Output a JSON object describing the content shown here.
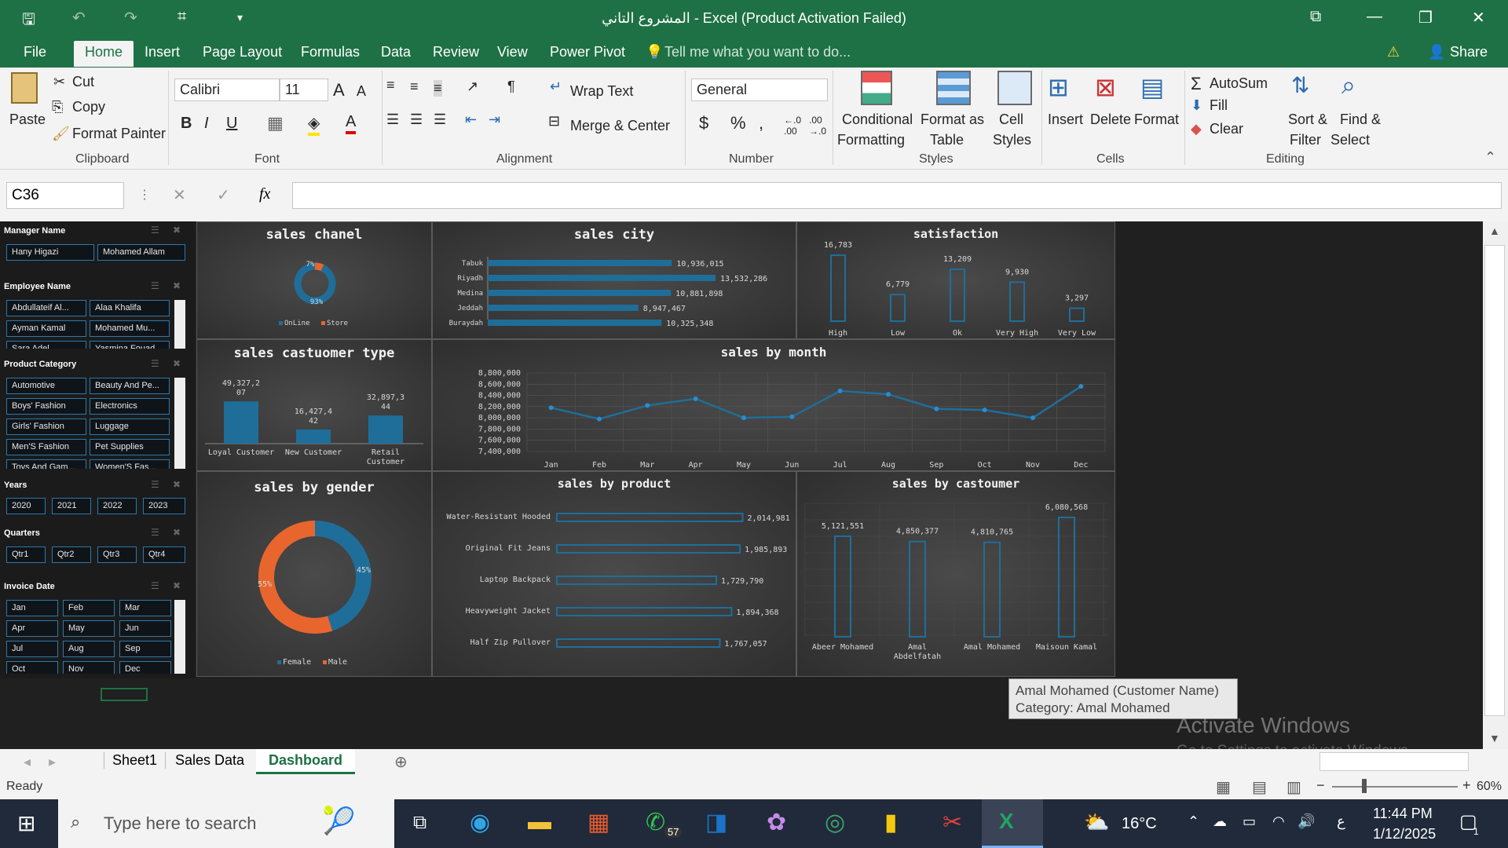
{
  "window": {
    "title": "المشروع التاني - Excel (Product Activation Failed)"
  },
  "tabs": [
    "File",
    "Home",
    "Insert",
    "Page Layout",
    "Formulas",
    "Data",
    "Review",
    "View",
    "Power Pivot"
  ],
  "tell_me": "Tell me what you want to do...",
  "share": "Share",
  "ribbon": {
    "paste": "Paste",
    "cut": "Cut",
    "copy": "Copy",
    "format_painter": "Format Painter",
    "clipboard": "Clipboard",
    "font_name": "Calibri",
    "font_size": "11",
    "font_group": "Font",
    "wrap_text": "Wrap Text",
    "merge_center": "Merge & Center",
    "alignment_group": "Alignment",
    "number_format": "General",
    "number_group": "Number",
    "conditional": "Conditional",
    "formatting": "Formatting",
    "format_as": "Format as",
    "table": "Table",
    "cell": "Cell",
    "styles": "Styles",
    "styles_group": "Styles",
    "insert": "Insert",
    "delete": "Delete",
    "format": "Format",
    "cells_group": "Cells",
    "autosum": "AutoSum",
    "fill": "Fill",
    "clear": "Clear",
    "sort": "Sort &",
    "filter": "Filter",
    "find": "Find &",
    "select": "Select",
    "editing_group": "Editing"
  },
  "formula_bar": {
    "name_box": "C36",
    "fx": "fx",
    "value": ""
  },
  "slicers": {
    "manager": {
      "title": "Manager Name",
      "items": [
        "Hany Higazi",
        "Mohamed Allam"
      ]
    },
    "employee": {
      "title": "Employee Name",
      "items": [
        "Abdullateif Al...",
        "Alaa Khalifa",
        "Ayman Kamal",
        "Mohamed Mu...",
        "Sara Adel",
        "Yasmina Fouad"
      ]
    },
    "category": {
      "title": "Product Category",
      "items": [
        "Automotive",
        "Beauty And Pe...",
        "Boys' Fashion",
        "Electronics",
        "Girls' Fashion",
        "Luggage",
        "Men'S Fashion",
        "Pet Supplies",
        "Toys And Gam...",
        "Women'S Fas..."
      ]
    },
    "years": {
      "title": "Years",
      "items": [
        "2020",
        "2021",
        "2022",
        "2023"
      ]
    },
    "quarters": {
      "title": "Quarters",
      "items": [
        "Qtr1",
        "Qtr2",
        "Qtr3",
        "Qtr4"
      ]
    },
    "invoice": {
      "title": "Invoice Date",
      "items": [
        "Jan",
        "Feb",
        "Mar",
        "Apr",
        "May",
        "Jun",
        "Jul",
        "Aug",
        "Sep",
        "Oct",
        "Nov",
        "Dec"
      ]
    }
  },
  "colors": {
    "accent": "#1f6e99",
    "orange": "#e8662e",
    "excel_green": "#1e7145"
  },
  "chart_data": [
    {
      "id": "channel",
      "type": "pie",
      "title": "sales chanel",
      "labels": [
        "OnLine",
        "Store"
      ],
      "values": [
        93,
        7
      ],
      "value_labels": [
        "93%",
        "7%"
      ]
    },
    {
      "id": "city",
      "type": "bar",
      "title": "sales city",
      "categories": [
        "Tabuk",
        "Riyadh",
        "Medina",
        "Jeddah",
        "Buraydah"
      ],
      "values": [
        10936015,
        13532286,
        10881898,
        8947467,
        10325348
      ],
      "value_labels": [
        "10,936,015",
        "13,532,286",
        "10,881,898",
        "8,947,467",
        "10,325,348"
      ]
    },
    {
      "id": "satisfaction",
      "type": "bar",
      "title": "satisfaction",
      "categories": [
        "High",
        "Low",
        "Ok",
        "Very High",
        "Very Low"
      ],
      "values": [
        16783,
        6779,
        13209,
        9930,
        3297
      ],
      "value_labels": [
        "16,783",
        "6,779",
        "13,209",
        "9,930",
        "3,297"
      ]
    },
    {
      "id": "customer_type",
      "type": "bar",
      "title": "sales castuomer type",
      "categories": [
        "Loyal Customer",
        "New Customer",
        "Retail Customer"
      ],
      "values": [
        49327207,
        16427442,
        32897344
      ],
      "value_labels": [
        "49,327,2\n07",
        "16,427,4\n42",
        "32,897,3\n44"
      ]
    },
    {
      "id": "month",
      "type": "line",
      "title": "sales by month",
      "categories": [
        "Jan",
        "Feb",
        "Mar",
        "Apr",
        "May",
        "Jun",
        "Jul",
        "Aug",
        "Sep",
        "Oct",
        "Nov",
        "Dec"
      ],
      "values": [
        8180000,
        7980000,
        8220000,
        8340000,
        8000000,
        8020000,
        8480000,
        8420000,
        8160000,
        8140000,
        8000000,
        8560000
      ],
      "yticks": [
        "8,800,000",
        "8,600,000",
        "8,400,000",
        "8,200,000",
        "8,000,000",
        "7,800,000",
        "7,600,000",
        "7,400,000"
      ],
      "ylim": [
        7400000,
        8800000
      ]
    },
    {
      "id": "gender",
      "type": "pie",
      "title": "sales by gender",
      "labels": [
        "Female",
        "Male"
      ],
      "values": [
        55,
        45
      ],
      "value_labels": [
        "55%",
        "45%"
      ]
    },
    {
      "id": "product",
      "type": "bar",
      "title": "sales by product",
      "categories": [
        "Water-Resistant Hooded",
        "Original Fit Jeans",
        "Laptop Backpack",
        "Heavyweight Jacket",
        "Half Zip Pullover"
      ],
      "values": [
        2014981,
        1985893,
        1729790,
        1894368,
        1767057
      ],
      "value_labels": [
        "2,014,981",
        "1,985,893",
        "1,729,790",
        "1,894,368",
        "1,767,057"
      ]
    },
    {
      "id": "customer",
      "type": "bar",
      "title": "sales by castoumer",
      "categories": [
        "Abeer Mohamed",
        "Amal Abdelfatah",
        "Amal Mohamed",
        "Maisoun Kamal"
      ],
      "values": [
        5121551,
        4850377,
        4810765,
        6080568
      ],
      "value_labels": [
        "5,121,551",
        "4,850,377",
        "4,810,765",
        "6,080,568"
      ]
    }
  ],
  "tooltip": {
    "line1": "Amal Mohamed  (Customer Name)",
    "line2": "Category:  Amal Mohamed"
  },
  "watermark": {
    "line1": "Activate Windows",
    "line2": "Go to Settings to activate Windows."
  },
  "sheet_tabs": [
    "Sheet1",
    "Sales Data",
    "Dashboard"
  ],
  "status": {
    "ready": "Ready",
    "zoom": "60%"
  },
  "taskbar": {
    "search": "Type here to search",
    "temp": "16°C",
    "time": "11:44 PM",
    "date": "1/12/2025",
    "whatsapp_badge": "57",
    "lang": "ع",
    "notif": "1"
  }
}
